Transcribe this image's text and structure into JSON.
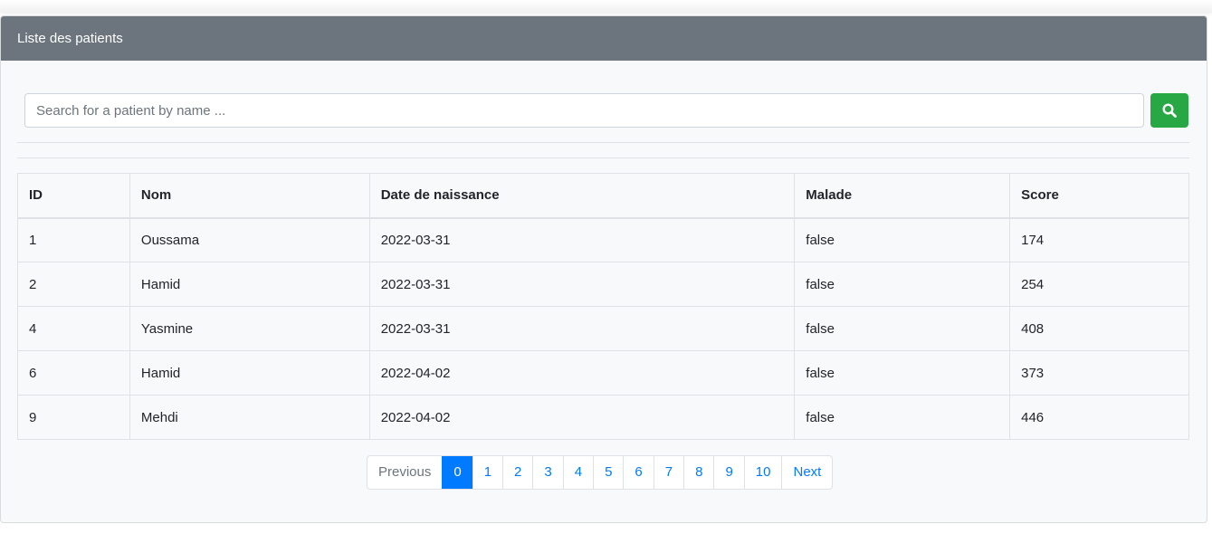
{
  "header": {
    "title": "Liste des patients"
  },
  "search": {
    "placeholder": "Search for a patient by name ...",
    "value": ""
  },
  "colors": {
    "header_bg": "#6c757d",
    "search_button": "#28a745",
    "accent": "#007bff"
  },
  "table": {
    "columns": [
      "ID",
      "Nom",
      "Date de naissance",
      "Malade",
      "Score"
    ],
    "rows": [
      [
        "1",
        "Oussama",
        "2022-03-31",
        "false",
        "174"
      ],
      [
        "2",
        "Hamid",
        "2022-03-31",
        "false",
        "254"
      ],
      [
        "4",
        "Yasmine",
        "2022-03-31",
        "false",
        "408"
      ],
      [
        "6",
        "Hamid",
        "2022-04-02",
        "false",
        "373"
      ],
      [
        "9",
        "Mehdi",
        "2022-04-02",
        "false",
        "446"
      ]
    ]
  },
  "pagination": {
    "previous_label": "Previous",
    "next_label": "Next",
    "pages": [
      "0",
      "1",
      "2",
      "3",
      "4",
      "5",
      "6",
      "7",
      "8",
      "9",
      "10"
    ],
    "active_page": "0"
  }
}
